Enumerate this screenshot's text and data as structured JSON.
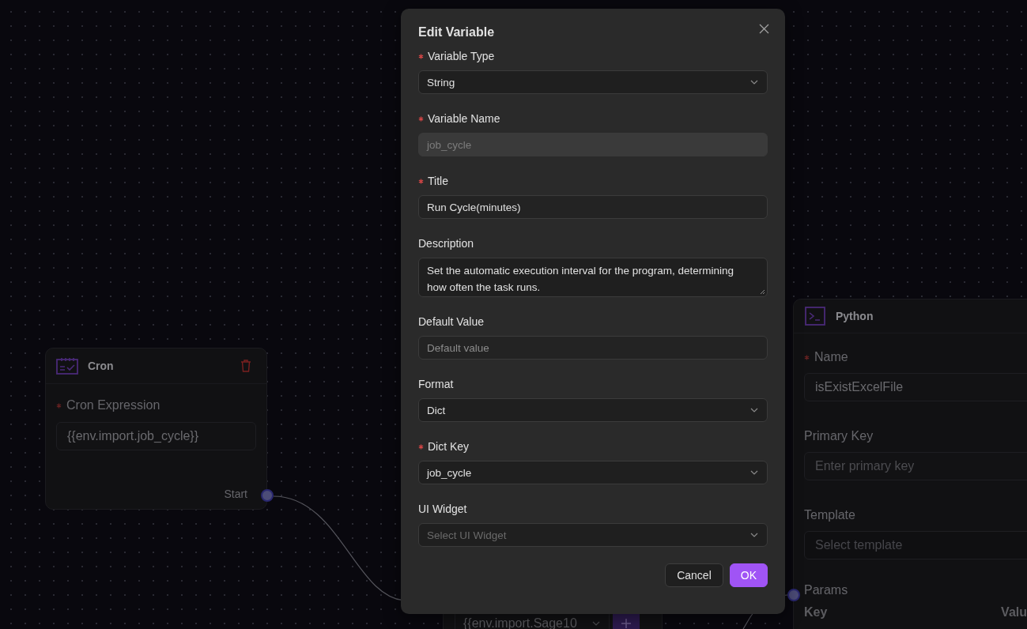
{
  "cron_node": {
    "title": "Cron",
    "field": {
      "label": "Cron Expression",
      "required": true,
      "value": "{{env.import.job_cycle}}"
    },
    "output_label": "Start"
  },
  "partial_node": {
    "field_value": "{{env.import.Sage10"
  },
  "python_node": {
    "title": "Python",
    "fields": [
      {
        "label": "Name",
        "required": true,
        "kind": "input",
        "value": "isExistExcelFile"
      },
      {
        "label": "Primary Key",
        "required": false,
        "kind": "input",
        "placeholder": "Enter primary key"
      },
      {
        "label": "Template",
        "required": false,
        "kind": "select",
        "placeholder": "Select template"
      }
    ],
    "params_label": "Params",
    "columns": [
      "Key",
      "Valu"
    ]
  },
  "modal": {
    "title": "Edit Variable",
    "fields": [
      {
        "label": "Variable Type",
        "required": true,
        "kind": "select",
        "value": "String",
        "disabled": false
      },
      {
        "label": "Variable Name",
        "required": true,
        "kind": "input",
        "value": "job_cycle",
        "disabled": true
      },
      {
        "label": "Title",
        "required": true,
        "kind": "input",
        "value": "Run Cycle(minutes)",
        "disabled": false
      },
      {
        "label": "Description",
        "required": false,
        "kind": "textarea",
        "value": "Set the automatic execution interval for the program, determining how often the task runs.",
        "disabled": false
      },
      {
        "label": "Default Value",
        "required": false,
        "kind": "input",
        "placeholder": "Default value",
        "disabled": false
      },
      {
        "label": "Format",
        "required": false,
        "kind": "select",
        "value": "Dict",
        "disabled": false
      },
      {
        "label": "Dict Key",
        "required": true,
        "kind": "select",
        "value": "job_cycle",
        "disabled": false
      },
      {
        "label": "UI Widget",
        "required": false,
        "kind": "select",
        "placeholder": "Select UI Widget",
        "disabled": false
      }
    ],
    "buttons": [
      {
        "label": "Cancel",
        "kind": "secondary"
      },
      {
        "label": "OK",
        "kind": "primary"
      }
    ]
  }
}
